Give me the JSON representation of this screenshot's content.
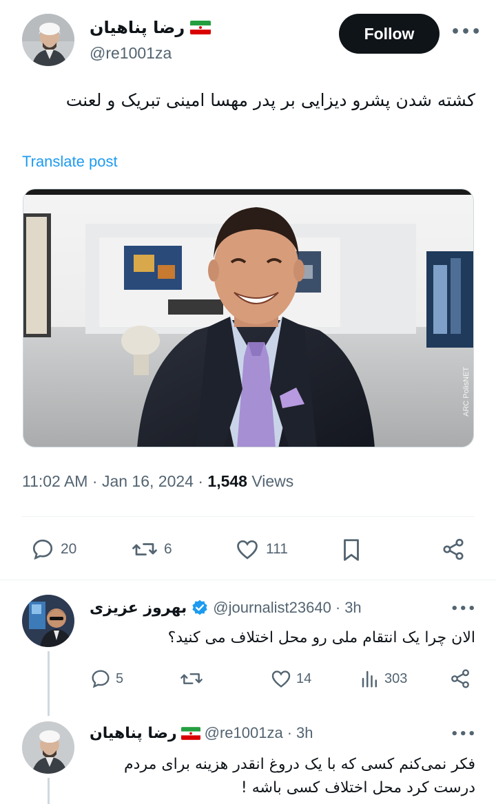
{
  "tweet": {
    "author_name": "رضا پناهیان",
    "author_handle": "@re1001za",
    "follow_label": "Follow",
    "text": "کشته شدن پشرو دیزایی بر پدر مهسا امینی تبریک و لعنت",
    "translate_label": "Translate post",
    "time": "11:02 AM",
    "date": "Jan 16, 2024",
    "views_count": "1,548",
    "views_label": "Views",
    "replies": "20",
    "reposts": "6",
    "likes": "111",
    "media_watermark": "ARC PolisNET"
  },
  "replies": [
    {
      "name": "بهروز عزیزی",
      "handle": "@journalist23640",
      "time": "3h",
      "text": "الان چرا یک انتقام ملی رو محل اختلاف می کنید؟",
      "replies": "5",
      "likes": "14",
      "views": "303"
    },
    {
      "name": "رضا پناهیان",
      "handle": "@re1001za",
      "time": "3h",
      "text": "فکر نمی‌کنم کسی که با یک دروغ انقدر هزینه برای مردم درست کرد محل اختلاف کسی باشه !"
    }
  ],
  "colors": {
    "accent": "#1d9bf0",
    "text": "#0f1419",
    "muted": "#536471",
    "verified": "#1d9bf0"
  }
}
